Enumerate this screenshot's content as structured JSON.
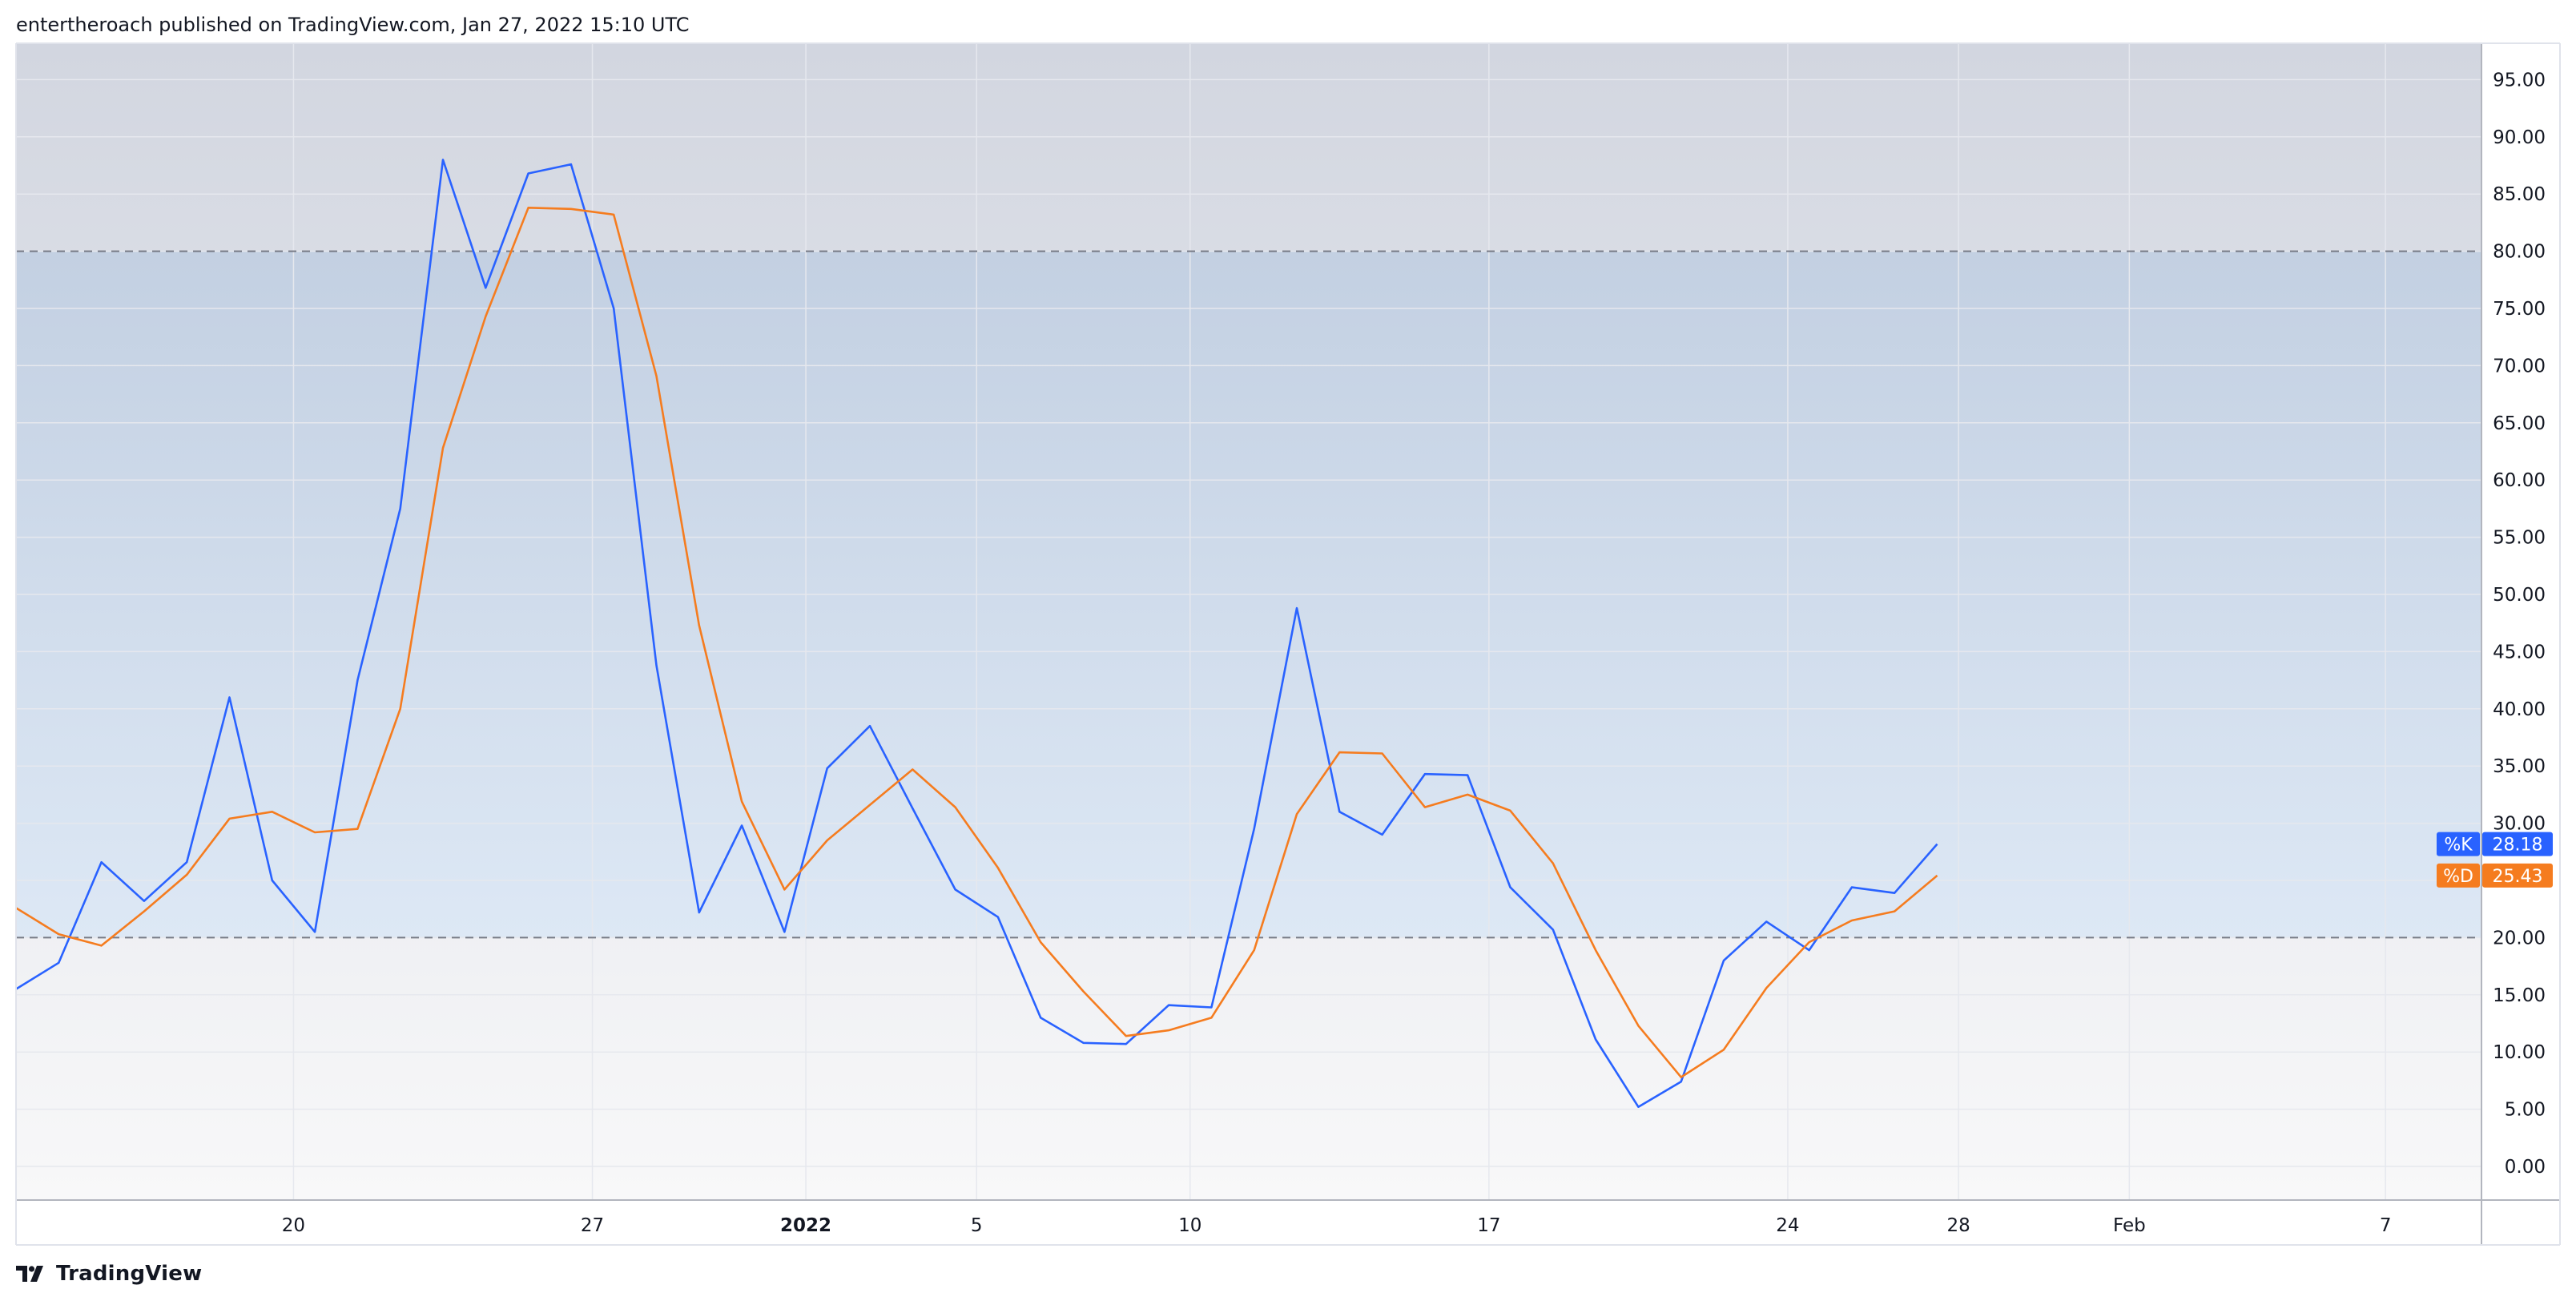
{
  "header": {
    "published": "entertheroach published on TradingView.com, Jan 27, 2022 15:10 UTC"
  },
  "footer": {
    "brand": "TradingView"
  },
  "colors": {
    "k_line": "#2962ff",
    "d_line": "#f57c1f",
    "band_top": "#c3d0e2",
    "band_bottom": "#dde8f5",
    "outer_top": "#d2d6e0",
    "outer_bottom": "#f8f8f9",
    "grid": "#e6e8ee",
    "text": "#131722"
  },
  "chart_data": {
    "type": "line",
    "indicator": "Stochastic",
    "y_ticks": [
      "95.00",
      "90.00",
      "85.00",
      "80.00",
      "75.00",
      "70.00",
      "65.00",
      "60.00",
      "55.00",
      "50.00",
      "45.00",
      "40.00",
      "35.00",
      "30.00",
      "25.00",
      "20.00",
      "15.00",
      "10.00",
      "5.00",
      "0.00"
    ],
    "x_ticks": [
      {
        "label": "20",
        "bar": 6.5,
        "bold": false
      },
      {
        "label": "27",
        "bar": 13.5,
        "bold": false
      },
      {
        "label": "2022",
        "bar": 18.5,
        "bold": true
      },
      {
        "label": "5",
        "bar": 22.5,
        "bold": false
      },
      {
        "label": "10",
        "bar": 27.5,
        "bold": false
      },
      {
        "label": "17",
        "bar": 34.5,
        "bold": false
      },
      {
        "label": "24",
        "bar": 41.5,
        "bold": false
      },
      {
        "label": "28",
        "bar": 45.5,
        "bold": false
      },
      {
        "label": "Feb",
        "bar": 49.5,
        "bold": false
      },
      {
        "label": "7",
        "bar": 55.5,
        "bold": false
      }
    ],
    "upper_band": 80,
    "lower_band": 20,
    "series": [
      {
        "name": "%K",
        "last_label": "28.18",
        "values": [
          15.5,
          17.8,
          26.6,
          23.2,
          26.6,
          41,
          25,
          20.5,
          42.5,
          57.5,
          88,
          76.8,
          86.8,
          87.6,
          75,
          43.8,
          22.2,
          29.8,
          20.5,
          34.8,
          38.5,
          31.3,
          24.2,
          21.8,
          13,
          10.8,
          10.7,
          14.1,
          13.9,
          29.5,
          48.8,
          31,
          29,
          34.3,
          34.2,
          24.4,
          20.7,
          11.1,
          5.2,
          7.4,
          18,
          21.4,
          18.9,
          24.4,
          23.9,
          28.18
        ]
      },
      {
        "name": "%D",
        "last_label": "25.43",
        "values": [
          22.6,
          20.3,
          19.3,
          22.3,
          25.5,
          30.4,
          31,
          29.2,
          29.5,
          40,
          62.8,
          74.3,
          83.8,
          83.7,
          83.2,
          69.1,
          47.3,
          31.9,
          24.2,
          28.5,
          31.6,
          34.7,
          31.4,
          26.1,
          19.6,
          15.3,
          11.4,
          11.9,
          13,
          18.9,
          30.8,
          36.2,
          36.1,
          31.4,
          32.5,
          31.1,
          26.5,
          18.9,
          12.3,
          7.8,
          10.2,
          15.6,
          19.6,
          21.5,
          22.3,
          25.43
        ]
      }
    ]
  }
}
